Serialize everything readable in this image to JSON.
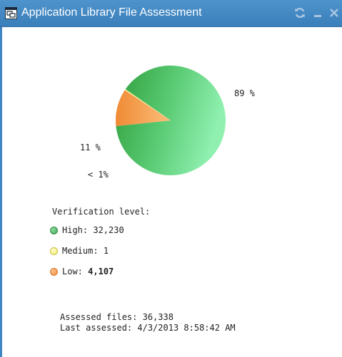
{
  "window": {
    "title": "Application Library File Assessment",
    "buttons": {
      "refresh_icon": "refresh-icon",
      "minimize_icon": "minimize-icon",
      "close_icon": "close-icon"
    }
  },
  "chart_data": {
    "type": "pie",
    "slices": [
      {
        "label": "89 %",
        "value": 89,
        "color": "#5ccc76"
      },
      {
        "label": "11 %",
        "value": 11,
        "color": "#f59c4d"
      },
      {
        "label": "< 1%",
        "value": 0.3,
        "color": "#f7f09a"
      }
    ]
  },
  "legend": {
    "title": "Verification level:",
    "items": [
      {
        "name": "High:",
        "count": "32,230",
        "color": "#53b86a"
      },
      {
        "name": "Medium:",
        "count": "1",
        "color": "#fbf79a"
      },
      {
        "name": "Low:",
        "count": "4,107",
        "color": "#f59c4d"
      }
    ]
  },
  "summary": {
    "assessed_files": "Assessed files: 36,338",
    "last_assessed": "Last assessed: 4/3/2013 8:58:42 AM"
  },
  "colors": {
    "titlebar": "#3f86c2",
    "title_text": "#ffffff"
  }
}
